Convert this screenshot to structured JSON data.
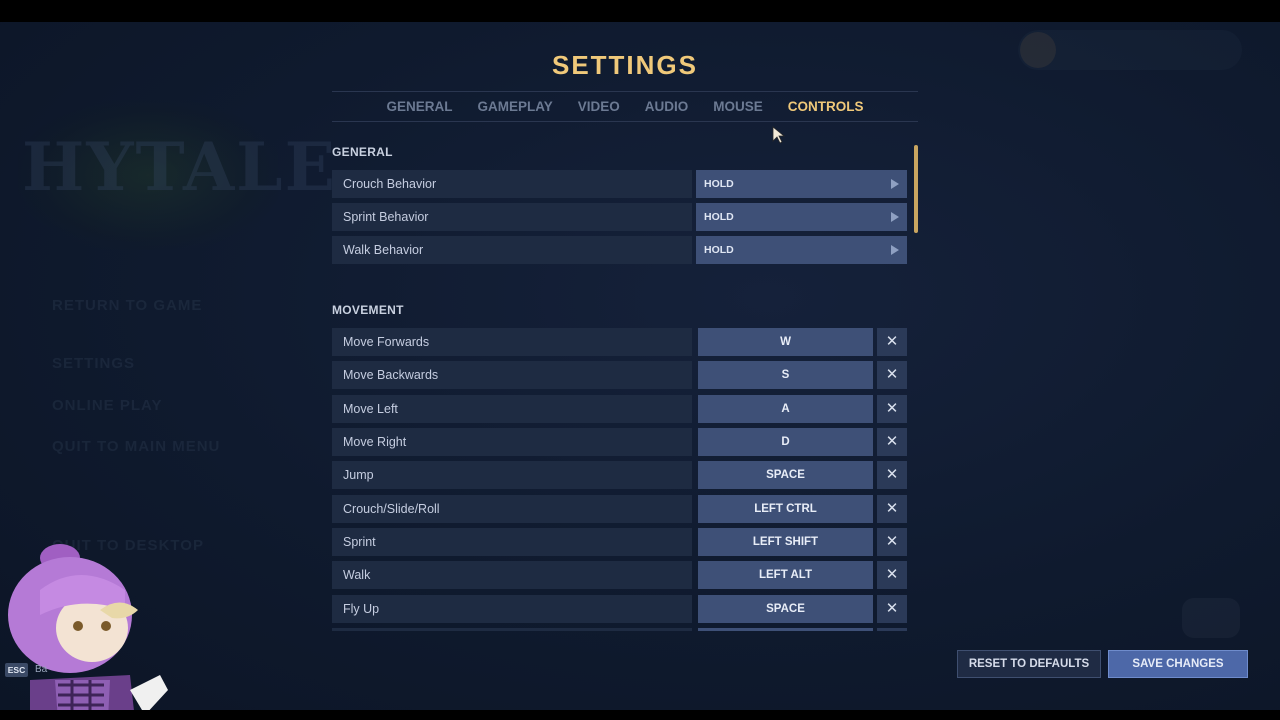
{
  "background_menu": {
    "logo_text": "HYTALE",
    "items": [
      "RETURN TO GAME",
      "SETTINGS",
      "ONLINE PLAY",
      "QUIT TO MAIN MENU",
      "QUIT TO DESKTOP"
    ]
  },
  "settings": {
    "title": "SETTINGS",
    "tabs": [
      {
        "label": "GENERAL",
        "active": false
      },
      {
        "label": "GAMEPLAY",
        "active": false
      },
      {
        "label": "VIDEO",
        "active": false
      },
      {
        "label": "AUDIO",
        "active": false
      },
      {
        "label": "MOUSE",
        "active": false
      },
      {
        "label": "CONTROLS",
        "active": true
      }
    ],
    "sections": {
      "general": {
        "header": "GENERAL",
        "rows": [
          {
            "label": "Crouch Behavior",
            "value": "HOLD"
          },
          {
            "label": "Sprint Behavior",
            "value": "HOLD"
          },
          {
            "label": "Walk Behavior",
            "value": "HOLD"
          }
        ]
      },
      "movement": {
        "header": "MOVEMENT",
        "rows": [
          {
            "label": "Move Forwards",
            "key": "W"
          },
          {
            "label": "Move Backwards",
            "key": "S"
          },
          {
            "label": "Move Left",
            "key": "A"
          },
          {
            "label": "Move Right",
            "key": "D"
          },
          {
            "label": "Jump",
            "key": "SPACE"
          },
          {
            "label": "Crouch/Slide/Roll",
            "key": "LEFT CTRL"
          },
          {
            "label": "Sprint",
            "key": "LEFT SHIFT"
          },
          {
            "label": "Walk",
            "key": "LEFT ALT"
          },
          {
            "label": "Fly Up",
            "key": "SPACE"
          }
        ]
      }
    },
    "clear_glyph": "✕",
    "buttons": {
      "reset": "RESET TO DEFAULTS",
      "save": "SAVE CHANGES"
    }
  },
  "footer": {
    "esc_key": "ESC",
    "esc_label": "Ba"
  },
  "colors": {
    "accent": "#f0c97a",
    "row_bg": "#1e2b42",
    "control_bg": "#3e5077",
    "primary_button": "#4d68a8"
  },
  "icons": {
    "select_arrow": "triangle-right-icon",
    "clear": "close-icon"
  }
}
